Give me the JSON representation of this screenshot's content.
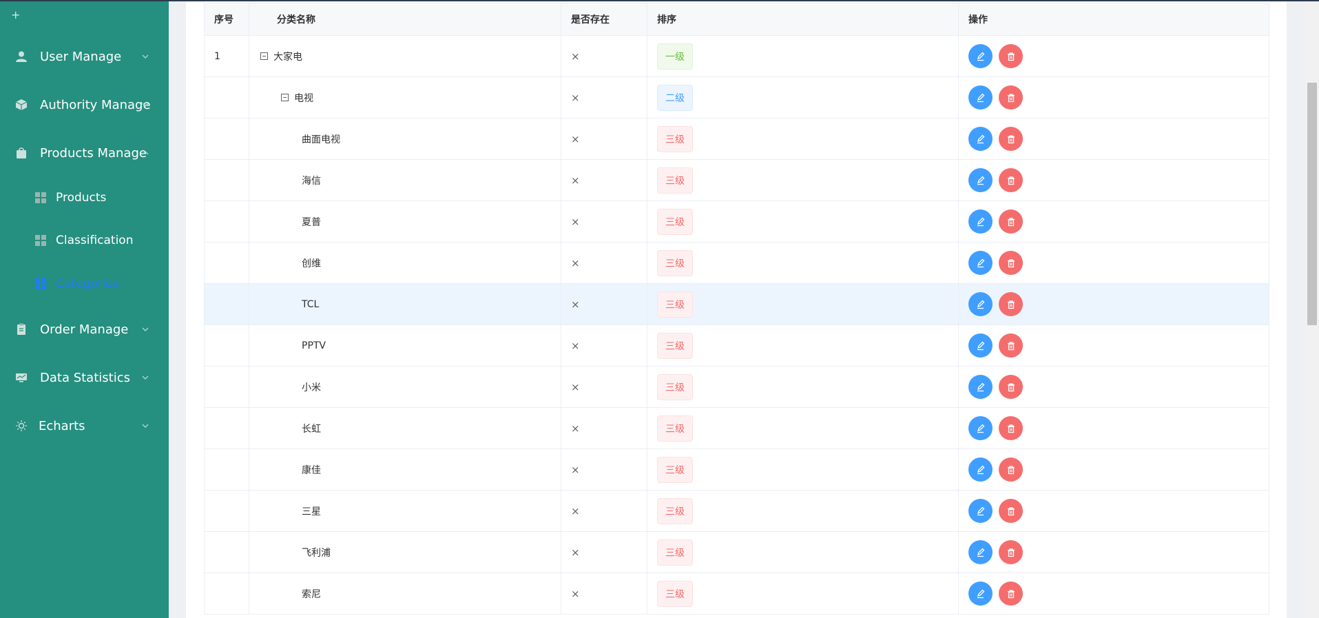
{
  "sidebar": {
    "collapse_symbol": "+",
    "items": [
      {
        "label": "User Manage",
        "icon": "user-icon"
      },
      {
        "label": "Authority Manage",
        "icon": "authority-box-icon"
      },
      {
        "label": "Products Manage",
        "icon": "bag-icon",
        "expanded": true,
        "children": [
          {
            "label": "Products",
            "icon": "grid-icon"
          },
          {
            "label": "Classification",
            "icon": "grid-icon"
          },
          {
            "label": "Categories",
            "icon": "grid-icon",
            "active": true
          }
        ]
      },
      {
        "label": "Order Manage",
        "icon": "clipboard-icon"
      },
      {
        "label": "Data Statistics",
        "icon": "monitor-icon"
      },
      {
        "label": "Echarts",
        "icon": "sun-icon"
      }
    ]
  },
  "table": {
    "headers": [
      "序号",
      "分类名称",
      "是否存在",
      "排序",
      "操作"
    ],
    "exists_symbol": "×",
    "rows": [
      {
        "index": "1",
        "name": "大家电",
        "level": "一级",
        "depth": 1
      },
      {
        "index": "",
        "name": "电视",
        "level": "二级",
        "depth": 2
      },
      {
        "index": "",
        "name": "曲面电视",
        "level": "三级",
        "depth": 3
      },
      {
        "index": "",
        "name": "海信",
        "level": "三级",
        "depth": 3
      },
      {
        "index": "",
        "name": "夏普",
        "level": "三级",
        "depth": 3
      },
      {
        "index": "",
        "name": "创维",
        "level": "三级",
        "depth": 3
      },
      {
        "index": "",
        "name": "TCL",
        "level": "三级",
        "depth": 3,
        "highlighted": true
      },
      {
        "index": "",
        "name": "PPTV",
        "level": "三级",
        "depth": 3
      },
      {
        "index": "",
        "name": "小米",
        "level": "三级",
        "depth": 3
      },
      {
        "index": "",
        "name": "长虹",
        "level": "三级",
        "depth": 3
      },
      {
        "index": "",
        "name": "康佳",
        "level": "三级",
        "depth": 3
      },
      {
        "index": "",
        "name": "三星",
        "level": "三级",
        "depth": 3
      },
      {
        "index": "",
        "name": "飞利浦",
        "level": "三级",
        "depth": 3
      },
      {
        "index": "",
        "name": "索尼",
        "level": "三级",
        "depth": 3
      }
    ]
  },
  "colors": {
    "sidebar_bg": "#258f80",
    "active_menu": "#1f7cff",
    "edit_button": "#409eff",
    "delete_button": "#f56c6c",
    "level1_tag": "#67c23a",
    "level2_tag": "#409eff",
    "level3_tag": "#f56c6c",
    "row_highlight": "#ecf5fd"
  }
}
